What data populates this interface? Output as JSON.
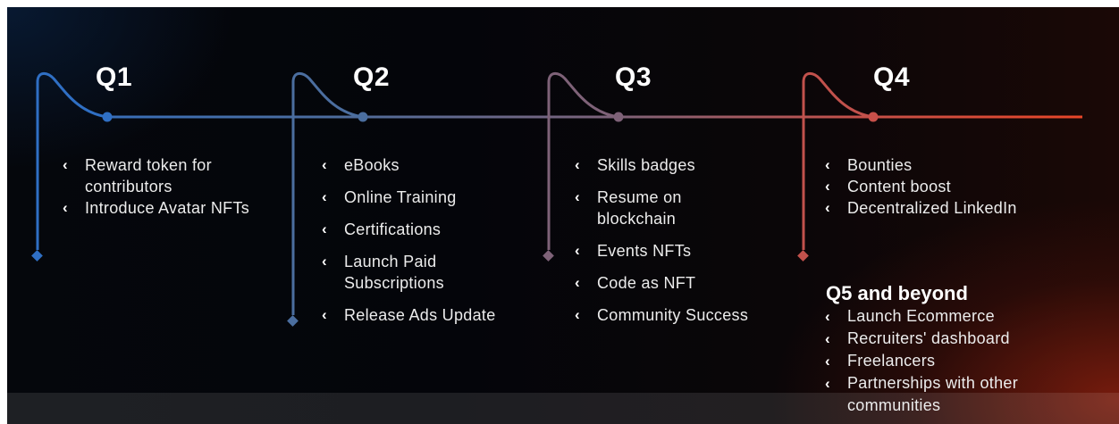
{
  "colors": {
    "q1": "#2f6fc4",
    "q2": "#4b6e9f",
    "q3": "#7e6278",
    "q4": "#c1514c",
    "q4_end": "#e84524"
  },
  "chevron_icon": "chevron-left-icon",
  "quarters": [
    {
      "label": "Q1",
      "items": [
        "Reward token for contributors",
        "Introduce Avatar NFTs"
      ]
    },
    {
      "label": "Q2",
      "items": [
        "eBooks",
        "Online Training",
        "Certifications",
        "Launch Paid Subscriptions",
        "Release Ads Update"
      ]
    },
    {
      "label": "Q3",
      "items": [
        "Skills badges",
        "Resume on blockchain",
        "Events NFTs",
        "Code as NFT",
        "Community Success"
      ]
    },
    {
      "label": "Q4",
      "items": [
        "Bounties",
        "Content boost",
        "Decentralized LinkedIn"
      ]
    }
  ],
  "q5": {
    "title": "Q5 and beyond",
    "items": [
      "Launch Ecommerce",
      "Recruiters' dashboard",
      "Freelancers",
      "Partnerships with other communities"
    ]
  }
}
